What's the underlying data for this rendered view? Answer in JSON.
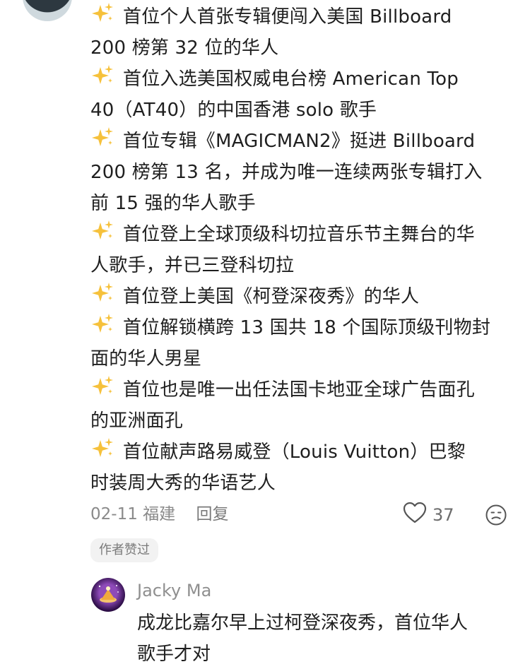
{
  "comment": {
    "lines": [
      {
        "sparkle": true,
        "text": "首位个人首张专辑便闯入美国 Billboard"
      },
      {
        "sparkle": false,
        "text": "200 榜第 32 位的华人"
      },
      {
        "sparkle": true,
        "text": "首位入选美国权威电台榜 American Top"
      },
      {
        "sparkle": false,
        "text": "40（AT40）的中国香港 solo 歌手"
      },
      {
        "sparkle": true,
        "text": "首位专辑《MAGICMAN2》挺进 Billboard"
      },
      {
        "sparkle": false,
        "text": "200 榜第 13 名，并成为唯一连续两张专辑打入"
      },
      {
        "sparkle": false,
        "text": "前 15 强的华人歌手"
      },
      {
        "sparkle": true,
        "text": "首位登上全球顶级科切拉音乐节主舞台的华"
      },
      {
        "sparkle": false,
        "text": "人歌手，并已三登科切拉"
      },
      {
        "sparkle": true,
        "text": "首位登上美国《柯登深夜秀》的华人"
      },
      {
        "sparkle": true,
        "text": "首位解锁横跨 13 国共 18 个国际顶级刊物封"
      },
      {
        "sparkle": false,
        "text": "面的华人男星"
      },
      {
        "sparkle": true,
        "text": "首位也是唯一出任法国卡地亚全球广告面孔"
      },
      {
        "sparkle": false,
        "text": "的亚洲面孔"
      },
      {
        "sparkle": true,
        "text": "首位献声路易威登（Louis Vuitton）巴黎"
      },
      {
        "sparkle": false,
        "text": "时装周大秀的华语艺人"
      }
    ],
    "meta": {
      "date": "02-11",
      "location": "福建",
      "reply_label": "回复",
      "like_count": "37"
    },
    "author_liked": "作者赞过"
  },
  "reply": {
    "name": "Jacky Ma",
    "lines": [
      "成龙比嘉尔早上过柯登深夜秀，首位华人",
      "歌手才对"
    ]
  },
  "icons": {
    "sparkle": "sparkles-icon",
    "like": "heart-outline-icon",
    "emoji": "emoji-face-icon"
  }
}
